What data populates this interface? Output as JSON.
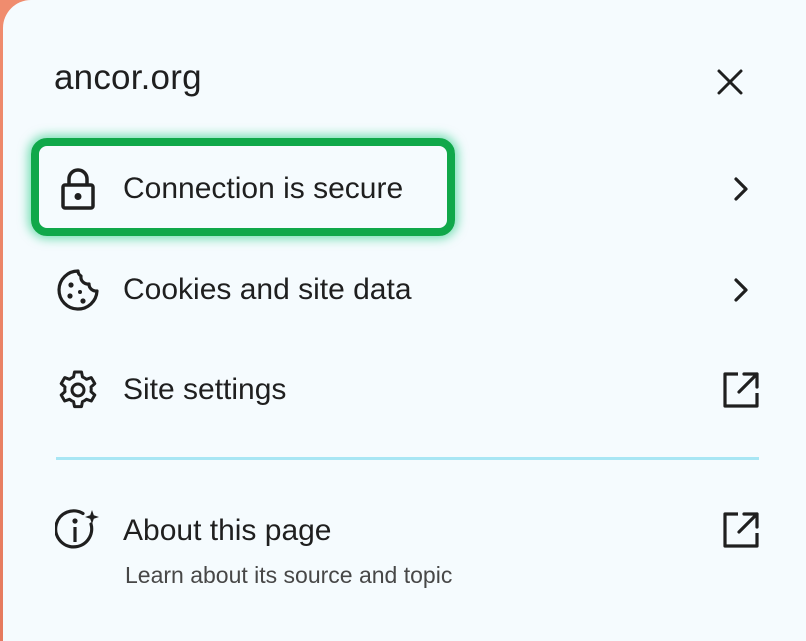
{
  "header": {
    "site": "ancor.org",
    "close_icon": "close-icon"
  },
  "menu": {
    "connection": {
      "label": "Connection is secure",
      "icon": "lock-icon",
      "trail": "chevron-right-icon"
    },
    "cookies": {
      "label": "Cookies and site data",
      "icon": "cookie-icon",
      "trail": "chevron-right-icon"
    },
    "settings": {
      "label": "Site settings",
      "icon": "gear-icon",
      "trail": "external-link-icon"
    },
    "about": {
      "label": "About this page",
      "sublabel": "Learn about its source and topic",
      "icon": "info-sparkle-icon",
      "trail": "external-link-icon"
    }
  },
  "colors": {
    "highlight": "#10a84a",
    "divider": "#a8e6f4",
    "panel_bg": "#f5fbfe",
    "text": "#1f1f1f"
  }
}
